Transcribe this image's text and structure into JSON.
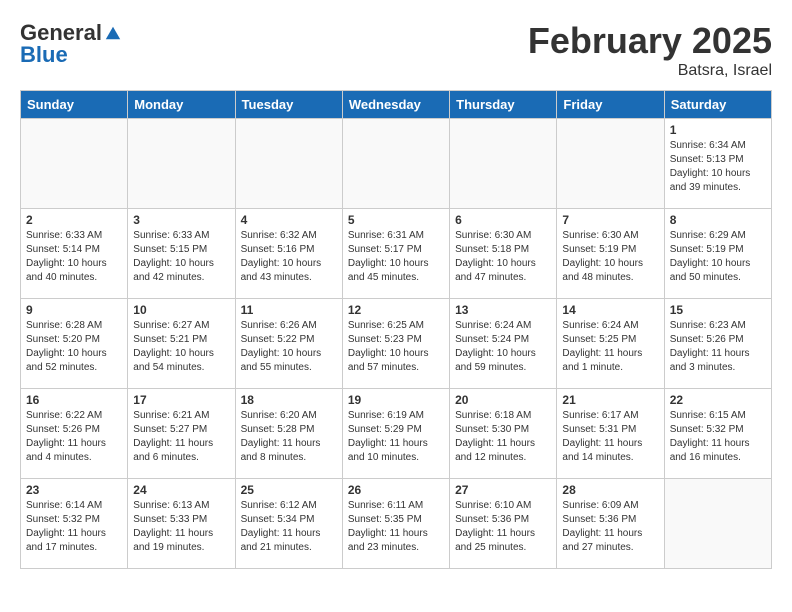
{
  "header": {
    "logo_general": "General",
    "logo_blue": "Blue",
    "title": "February 2025",
    "subtitle": "Batsra, Israel"
  },
  "weekdays": [
    "Sunday",
    "Monday",
    "Tuesday",
    "Wednesday",
    "Thursday",
    "Friday",
    "Saturday"
  ],
  "weeks": [
    [
      {
        "day": "",
        "info": ""
      },
      {
        "day": "",
        "info": ""
      },
      {
        "day": "",
        "info": ""
      },
      {
        "day": "",
        "info": ""
      },
      {
        "day": "",
        "info": ""
      },
      {
        "day": "",
        "info": ""
      },
      {
        "day": "1",
        "info": "Sunrise: 6:34 AM\nSunset: 5:13 PM\nDaylight: 10 hours and 39 minutes."
      }
    ],
    [
      {
        "day": "2",
        "info": "Sunrise: 6:33 AM\nSunset: 5:14 PM\nDaylight: 10 hours and 40 minutes."
      },
      {
        "day": "3",
        "info": "Sunrise: 6:33 AM\nSunset: 5:15 PM\nDaylight: 10 hours and 42 minutes."
      },
      {
        "day": "4",
        "info": "Sunrise: 6:32 AM\nSunset: 5:16 PM\nDaylight: 10 hours and 43 minutes."
      },
      {
        "day": "5",
        "info": "Sunrise: 6:31 AM\nSunset: 5:17 PM\nDaylight: 10 hours and 45 minutes."
      },
      {
        "day": "6",
        "info": "Sunrise: 6:30 AM\nSunset: 5:18 PM\nDaylight: 10 hours and 47 minutes."
      },
      {
        "day": "7",
        "info": "Sunrise: 6:30 AM\nSunset: 5:19 PM\nDaylight: 10 hours and 48 minutes."
      },
      {
        "day": "8",
        "info": "Sunrise: 6:29 AM\nSunset: 5:19 PM\nDaylight: 10 hours and 50 minutes."
      }
    ],
    [
      {
        "day": "9",
        "info": "Sunrise: 6:28 AM\nSunset: 5:20 PM\nDaylight: 10 hours and 52 minutes."
      },
      {
        "day": "10",
        "info": "Sunrise: 6:27 AM\nSunset: 5:21 PM\nDaylight: 10 hours and 54 minutes."
      },
      {
        "day": "11",
        "info": "Sunrise: 6:26 AM\nSunset: 5:22 PM\nDaylight: 10 hours and 55 minutes."
      },
      {
        "day": "12",
        "info": "Sunrise: 6:25 AM\nSunset: 5:23 PM\nDaylight: 10 hours and 57 minutes."
      },
      {
        "day": "13",
        "info": "Sunrise: 6:24 AM\nSunset: 5:24 PM\nDaylight: 10 hours and 59 minutes."
      },
      {
        "day": "14",
        "info": "Sunrise: 6:24 AM\nSunset: 5:25 PM\nDaylight: 11 hours and 1 minute."
      },
      {
        "day": "15",
        "info": "Sunrise: 6:23 AM\nSunset: 5:26 PM\nDaylight: 11 hours and 3 minutes."
      }
    ],
    [
      {
        "day": "16",
        "info": "Sunrise: 6:22 AM\nSunset: 5:26 PM\nDaylight: 11 hours and 4 minutes."
      },
      {
        "day": "17",
        "info": "Sunrise: 6:21 AM\nSunset: 5:27 PM\nDaylight: 11 hours and 6 minutes."
      },
      {
        "day": "18",
        "info": "Sunrise: 6:20 AM\nSunset: 5:28 PM\nDaylight: 11 hours and 8 minutes."
      },
      {
        "day": "19",
        "info": "Sunrise: 6:19 AM\nSunset: 5:29 PM\nDaylight: 11 hours and 10 minutes."
      },
      {
        "day": "20",
        "info": "Sunrise: 6:18 AM\nSunset: 5:30 PM\nDaylight: 11 hours and 12 minutes."
      },
      {
        "day": "21",
        "info": "Sunrise: 6:17 AM\nSunset: 5:31 PM\nDaylight: 11 hours and 14 minutes."
      },
      {
        "day": "22",
        "info": "Sunrise: 6:15 AM\nSunset: 5:32 PM\nDaylight: 11 hours and 16 minutes."
      }
    ],
    [
      {
        "day": "23",
        "info": "Sunrise: 6:14 AM\nSunset: 5:32 PM\nDaylight: 11 hours and 17 minutes."
      },
      {
        "day": "24",
        "info": "Sunrise: 6:13 AM\nSunset: 5:33 PM\nDaylight: 11 hours and 19 minutes."
      },
      {
        "day": "25",
        "info": "Sunrise: 6:12 AM\nSunset: 5:34 PM\nDaylight: 11 hours and 21 minutes."
      },
      {
        "day": "26",
        "info": "Sunrise: 6:11 AM\nSunset: 5:35 PM\nDaylight: 11 hours and 23 minutes."
      },
      {
        "day": "27",
        "info": "Sunrise: 6:10 AM\nSunset: 5:36 PM\nDaylight: 11 hours and 25 minutes."
      },
      {
        "day": "28",
        "info": "Sunrise: 6:09 AM\nSunset: 5:36 PM\nDaylight: 11 hours and 27 minutes."
      },
      {
        "day": "",
        "info": ""
      }
    ]
  ]
}
